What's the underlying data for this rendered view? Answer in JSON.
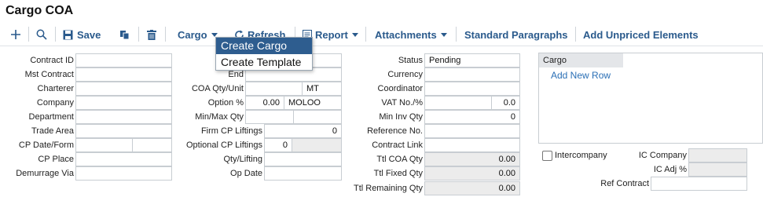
{
  "title": "Cargo COA",
  "toolbar": {
    "save": "Save",
    "cargo": "Cargo",
    "refresh": "Refresh",
    "report": "Report",
    "attachments": "Attachments",
    "standard_paragraphs": "Standard Paragraphs",
    "add_unpriced": "Add Unpriced Elements"
  },
  "cargo_menu": {
    "items": [
      "Create Cargo",
      "Create Template"
    ]
  },
  "col1": {
    "labels": [
      "Contract ID",
      "Mst Contract",
      "Charterer",
      "Company",
      "Department",
      "Trade Area",
      "CP Date/Form",
      "CP Place",
      "Demurrage Via"
    ]
  },
  "col2": {
    "labels": [
      "End",
      "COA Qty/Unit",
      "Option %",
      "Min/Max Qty",
      "Firm CP Liftings",
      "Optional CP Liftings",
      "Qty/Lifting",
      "Op Date"
    ],
    "coa_unit": "MT",
    "option_pct": "0.00",
    "option_mode": "MOLOO",
    "firm_liftings": "0",
    "optional_liftings": "0"
  },
  "col3": {
    "labels": [
      "Status",
      "Currency",
      "Coordinator",
      "VAT No./%",
      "Min Inv Qty",
      "Reference No.",
      "Contract Link",
      "Ttl COA Qty",
      "Ttl Fixed Qty",
      "Ttl Remaining Qty"
    ],
    "status": "Pending",
    "vat_pct": "0.0",
    "min_inv_qty": "0",
    "ttl_coa_qty": "0.00",
    "ttl_fixed_qty": "0.00",
    "ttl_remaining_qty": "0.00"
  },
  "cargo_panel": {
    "header": "Cargo",
    "add_row": "Add New Row"
  },
  "col4": {
    "intercompany": "Intercompany",
    "ic_company": "IC Company",
    "ic_adj": "IC Adj %",
    "ref_contract": "Ref Contract"
  },
  "colors": {
    "accent": "#2a5a8c",
    "menu_selected": "#2e5d8f",
    "link": "#2a6fb5",
    "readonly_bg": "#ececec"
  }
}
